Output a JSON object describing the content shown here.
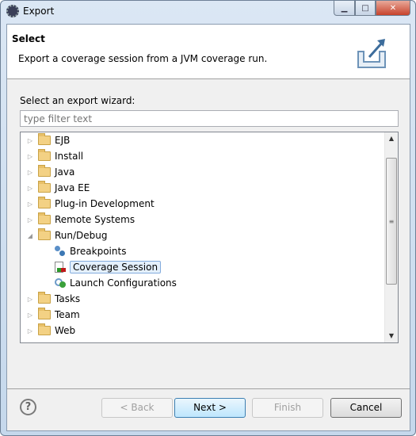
{
  "window": {
    "title": "Export",
    "controls": [
      "minimize",
      "maximize",
      "close"
    ]
  },
  "header": {
    "title": "Select",
    "description": "Export a coverage session from a JVM coverage run."
  },
  "wizard_label": "Select an export wizard:",
  "filter": {
    "value": "",
    "placeholder": "type filter text"
  },
  "tree": [
    {
      "label": "EJB",
      "type": "folder",
      "expanded": false
    },
    {
      "label": "Install",
      "type": "folder",
      "expanded": false
    },
    {
      "label": "Java",
      "type": "folder",
      "expanded": false
    },
    {
      "label": "Java EE",
      "type": "folder",
      "expanded": false
    },
    {
      "label": "Plug-in Development",
      "type": "folder",
      "expanded": false
    },
    {
      "label": "Remote Systems",
      "type": "folder",
      "expanded": false
    },
    {
      "label": "Run/Debug",
      "type": "folder",
      "expanded": true
    },
    {
      "label": "Breakpoints",
      "type": "breakpoints-icon",
      "child": true
    },
    {
      "label": "Coverage Session",
      "type": "coverage-icon",
      "child": true,
      "selected": true
    },
    {
      "label": "Launch Configurations",
      "type": "launch-icon",
      "child": true
    },
    {
      "label": "Tasks",
      "type": "folder",
      "expanded": false
    },
    {
      "label": "Team",
      "type": "folder",
      "expanded": false
    },
    {
      "label": "Web",
      "type": "folder",
      "expanded": false
    }
  ],
  "buttons": {
    "back": "< Back",
    "next": "Next >",
    "finish": "Finish",
    "cancel": "Cancel",
    "help": "?"
  }
}
